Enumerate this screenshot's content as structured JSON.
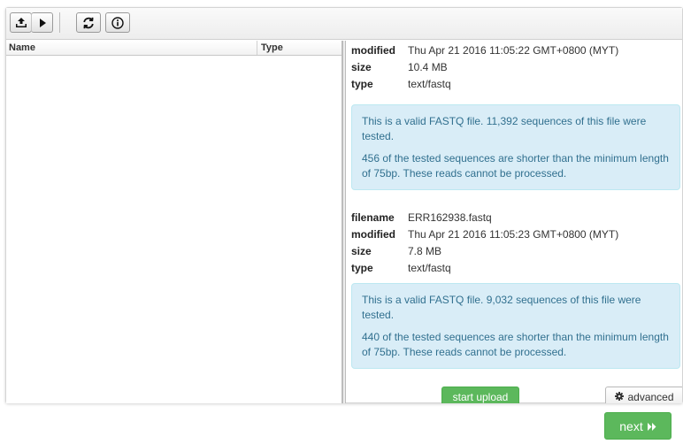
{
  "toolbar": {
    "buttons": [
      {
        "icon": "upload-icon"
      },
      {
        "icon": "play-icon"
      },
      {
        "icon": "refresh-icon"
      },
      {
        "icon": "info-icon"
      }
    ]
  },
  "file_table": {
    "columns": [
      "Name",
      "Type"
    ],
    "rows": []
  },
  "details": {
    "file1": {
      "meta": [
        {
          "key": "modified",
          "value": "Thu Apr 21 2016 11:05:22 GMT+0800 (MYT)"
        },
        {
          "key": "size",
          "value": "10.4 MB"
        },
        {
          "key": "type",
          "value": "text/fastq"
        }
      ],
      "alert": [
        "This is a valid FASTQ file. 11,392 sequences of this file were tested.",
        "456 of the tested sequences are shorter than the minimum length of 75bp. These reads cannot be processed."
      ]
    },
    "file2": {
      "meta": [
        {
          "key": "filename",
          "value": "ERR162938.fastq"
        },
        {
          "key": "modified",
          "value": "Thu Apr 21 2016 11:05:23 GMT+0800 (MYT)"
        },
        {
          "key": "size",
          "value": "7.8 MB"
        },
        {
          "key": "type",
          "value": "text/fastq"
        }
      ],
      "alert": [
        "This is a valid FASTQ file. 9,032 sequences of this file were tested.",
        "440 of the tested sequences are shorter than the minimum length of 75bp. These reads cannot be processed."
      ]
    }
  },
  "actions": {
    "start_upload": "start upload",
    "advanced": "advanced",
    "advanced_icon": "gear-icon",
    "next": "next",
    "next_icon": "double-chevron-right-icon"
  },
  "colors": {
    "success": "#5cb85c",
    "info_bg": "#d9edf7",
    "info_text": "#31708f"
  }
}
